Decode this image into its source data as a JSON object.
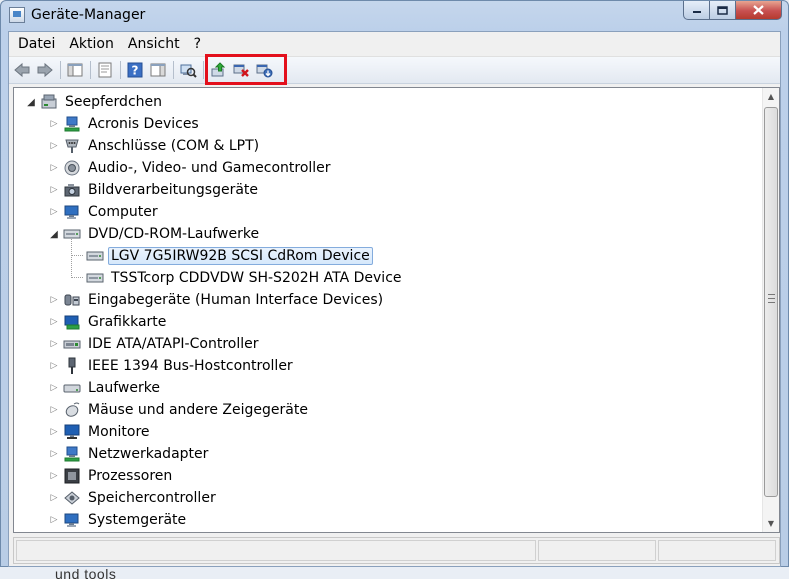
{
  "window": {
    "title": "Geräte-Manager",
    "buttons": {
      "minimize": "−",
      "maximize": "□",
      "close": "✕"
    }
  },
  "menu": [
    {
      "id": "datei",
      "label": "Datei"
    },
    {
      "id": "aktion",
      "label": "Aktion"
    },
    {
      "id": "ansicht",
      "label": "Ansicht"
    },
    {
      "id": "hilfe",
      "label": "?"
    }
  ],
  "toolbar": {
    "buttons": [
      {
        "id": "back",
        "icon": "back-arrow-icon"
      },
      {
        "id": "forward",
        "icon": "forward-arrow-icon"
      },
      {
        "id": "show-hide-tree",
        "icon": "console-tree-icon"
      },
      {
        "id": "properties",
        "icon": "properties-icon"
      },
      {
        "id": "help",
        "icon": "help-icon"
      },
      {
        "id": "action-pane",
        "icon": "action-pane-icon"
      },
      {
        "id": "scan-hardware",
        "icon": "scan-hardware-icon"
      },
      {
        "id": "update-driver",
        "icon": "update-driver-icon"
      },
      {
        "id": "uninstall",
        "icon": "uninstall-device-icon"
      },
      {
        "id": "disable",
        "icon": "disable-device-icon"
      }
    ],
    "highlight_color": "#e3101c"
  },
  "tree": {
    "root": {
      "label": "Seepferdchen",
      "icon": "computer-root-icon"
    },
    "categories": [
      {
        "label": "Acronis Devices",
        "icon": "network-device-icon",
        "expanded": false
      },
      {
        "label": "Anschlüsse (COM & LPT)",
        "icon": "port-icon",
        "expanded": false
      },
      {
        "label": "Audio-, Video- und Gamecontroller",
        "icon": "speaker-icon",
        "expanded": false
      },
      {
        "label": "Bildverarbeitungsgeräte",
        "icon": "camera-icon",
        "expanded": false
      },
      {
        "label": "Computer",
        "icon": "computer-icon",
        "expanded": false
      },
      {
        "label": "DVD/CD-ROM-Laufwerke",
        "icon": "optical-drive-icon",
        "expanded": true,
        "children": [
          {
            "label": "LGV 7G5IRW92B SCSI CdRom Device",
            "icon": "optical-drive-icon",
            "selected": true
          },
          {
            "label": "TSSTcorp CDDVDW SH-S202H ATA Device",
            "icon": "optical-drive-icon",
            "selected": false
          }
        ]
      },
      {
        "label": "Eingabegeräte (Human Interface Devices)",
        "icon": "hid-icon",
        "expanded": false
      },
      {
        "label": "Grafikkarte",
        "icon": "display-adapter-icon",
        "expanded": false
      },
      {
        "label": "IDE ATA/ATAPI-Controller",
        "icon": "ide-controller-icon",
        "expanded": false
      },
      {
        "label": "IEEE 1394 Bus-Hostcontroller",
        "icon": "firewire-icon",
        "expanded": false
      },
      {
        "label": "Laufwerke",
        "icon": "disk-drive-icon",
        "expanded": false
      },
      {
        "label": "Mäuse und andere Zeigegeräte",
        "icon": "mouse-icon",
        "expanded": false
      },
      {
        "label": "Monitore",
        "icon": "monitor-icon",
        "expanded": false
      },
      {
        "label": "Netzwerkadapter",
        "icon": "network-adapter-icon",
        "expanded": false
      },
      {
        "label": "Prozessoren",
        "icon": "processor-icon",
        "expanded": false
      },
      {
        "label": "Speichercontroller",
        "icon": "storage-controller-icon",
        "expanded": false
      },
      {
        "label": "Systemgeräte",
        "icon": "system-devices-icon",
        "expanded": false
      }
    ]
  },
  "background_text": "und tools"
}
